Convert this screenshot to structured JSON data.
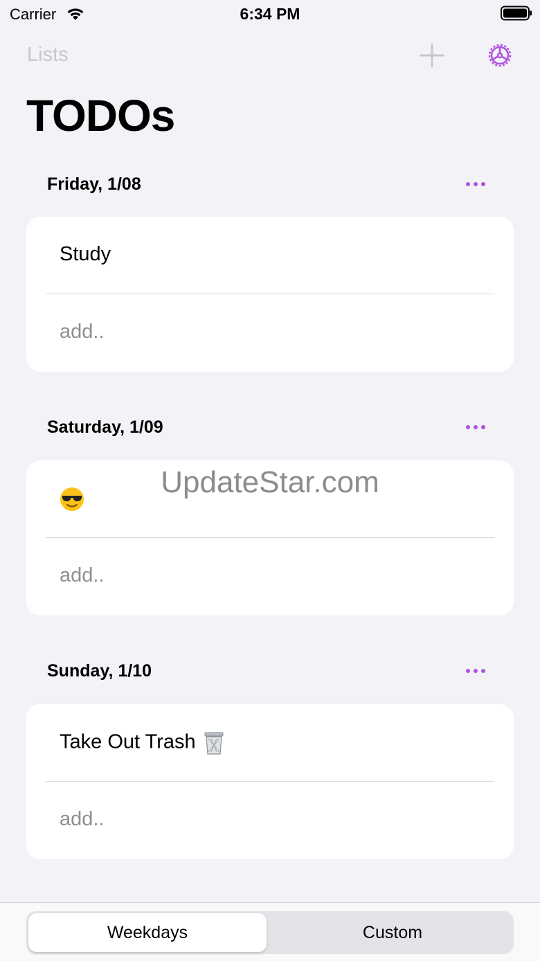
{
  "status_bar": {
    "carrier": "Carrier",
    "time": "6:34 PM"
  },
  "nav": {
    "back_label": "Lists",
    "title": "TODOs"
  },
  "accent_color": "#af52de",
  "sections": [
    {
      "header": "Friday, 1/08",
      "items": [
        "Study"
      ],
      "add_placeholder": "add.."
    },
    {
      "header": "Saturday, 1/09",
      "items": [
        ""
      ],
      "item_icon": "smiling-face-with-sunglasses-icon",
      "add_placeholder": "add.."
    },
    {
      "header": "Sunday, 1/10",
      "items": [
        "Take Out Trash"
      ],
      "item_icon": "wastebasket-icon",
      "add_placeholder": "add.."
    }
  ],
  "watermark": "UpdateStar.com",
  "segmented_control": {
    "options": [
      "Weekdays",
      "Custom"
    ],
    "selected": "Weekdays"
  }
}
